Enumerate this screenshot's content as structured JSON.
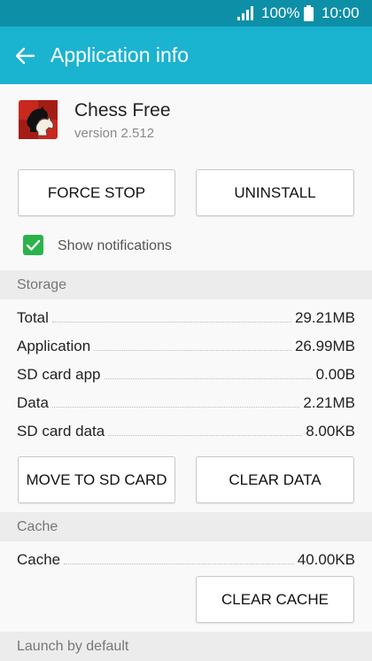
{
  "status_bar": {
    "battery": "100%",
    "time": "10:00"
  },
  "app_bar": {
    "title": "Application info"
  },
  "app": {
    "name": "Chess Free",
    "version": "version 2.512"
  },
  "buttons": {
    "force_stop": "FORCE STOP",
    "uninstall": "UNINSTALL",
    "move_to_sd": "MOVE TO SD CARD",
    "clear_data": "CLEAR DATA",
    "clear_cache": "CLEAR CACHE"
  },
  "notifications": {
    "label": "Show notifications",
    "checked": true
  },
  "storage": {
    "header": "Storage",
    "rows": [
      {
        "label": "Total",
        "value": "29.21MB"
      },
      {
        "label": "Application",
        "value": "26.99MB"
      },
      {
        "label": "SD card app",
        "value": "0.00B"
      },
      {
        "label": "Data",
        "value": "2.21MB"
      },
      {
        "label": "SD card data",
        "value": "8.00KB"
      }
    ]
  },
  "cache": {
    "header": "Cache",
    "rows": [
      {
        "label": "Cache",
        "value": "40.00KB"
      }
    ]
  },
  "launch": {
    "header": "Launch by default"
  },
  "colors": {
    "status_bar": "#0d8fa8",
    "app_bar": "#1ab3d0",
    "checkbox": "#2bb34a"
  }
}
